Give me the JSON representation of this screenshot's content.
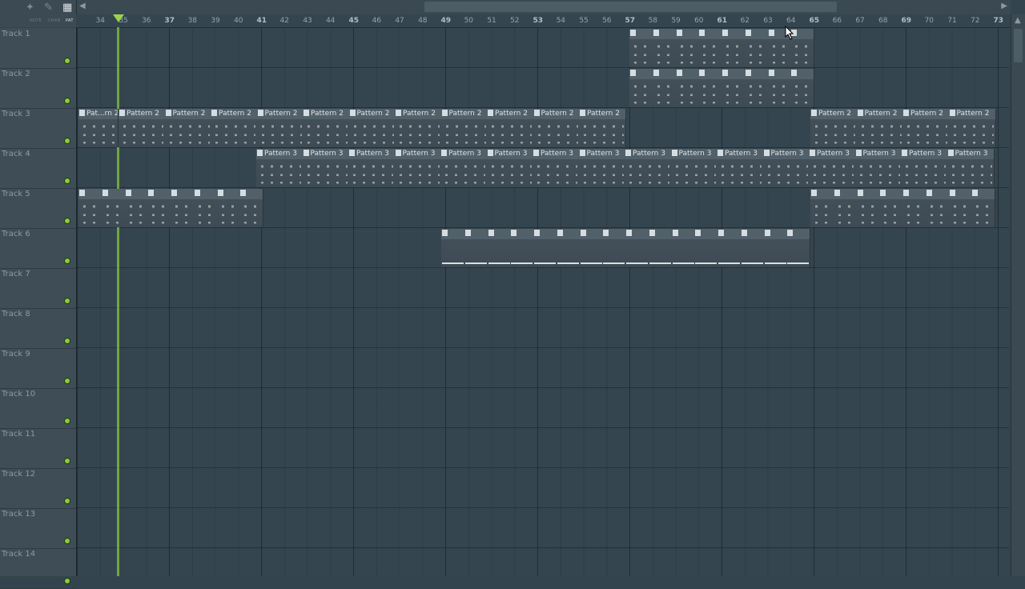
{
  "toolbar": {
    "label_note": "NOTE",
    "label_chan": "CHAN",
    "label_pat": "PAT"
  },
  "ruler": {
    "numbers": [
      "34",
      "35",
      "36",
      "37",
      "38",
      "39",
      "40",
      "41",
      "42",
      "43",
      "44",
      "45",
      "46",
      "47",
      "48",
      "49",
      "50",
      "51",
      "52",
      "53",
      "54",
      "55",
      "56",
      "57",
      "58",
      "59",
      "60",
      "61",
      "62",
      "63",
      "64",
      "65",
      "66",
      "67",
      "68",
      "69",
      "70",
      "71",
      "72",
      "73"
    ]
  },
  "tracks": [
    {
      "name": "Track 1"
    },
    {
      "name": "Track 2"
    },
    {
      "name": "Track 3"
    },
    {
      "name": "Track 4"
    },
    {
      "name": "Track 5"
    },
    {
      "name": "Track 6"
    },
    {
      "name": "Track 7"
    },
    {
      "name": "Track 8"
    },
    {
      "name": "Track 9"
    },
    {
      "name": "Track 10"
    },
    {
      "name": "Track 11"
    },
    {
      "name": "Track 12"
    },
    {
      "name": "Track 13"
    },
    {
      "name": "Track 14"
    }
  ],
  "clip_labels": {
    "pattern_2_short": "Pat...rn 2",
    "pattern_2": "Pattern 2",
    "pattern_3": "Pattern 3"
  },
  "colors": {
    "playhead": "#8ccc3c",
    "background": "#34444e",
    "clip": "#52606a"
  }
}
